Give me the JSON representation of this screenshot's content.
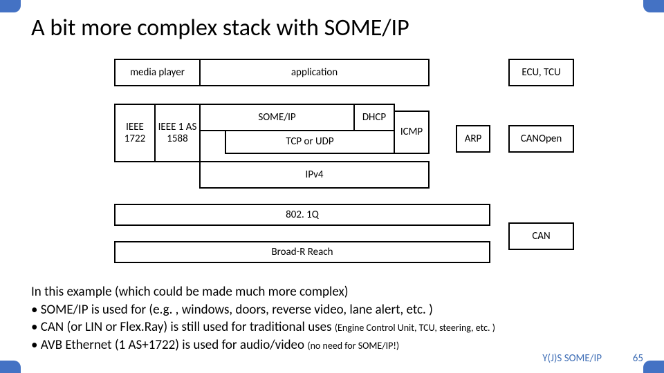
{
  "title": "A bit more complex stack with SOME/IP",
  "diagram": {
    "media_player": "media player",
    "application": "application",
    "ecu_tcu": "ECU, TCU",
    "ieee1722": "IEEE 1722",
    "ieee1as": "IEEE 1 AS 1588",
    "someip": "SOME/IP",
    "dhcp": "DHCP",
    "tcp_udp": "TCP or UDP",
    "icmp": "ICMP",
    "ipv4": "IPv4",
    "arp": "ARP",
    "canopen": "CANOpen",
    "q8021": "802. 1Q",
    "broadr": "Broad-R Reach",
    "can": "CAN"
  },
  "body": {
    "intro": "In this example (which could be made much more complex)",
    "b1": "SOME/IP is used for (e.g. , windows, doors, reverse video, lane alert, etc. )",
    "b2a": "CAN (or LIN or Flex.Ray) is still used for traditional uses ",
    "b2b": "(Engine Control Unit, TCU, steering, etc. )",
    "b3a": "AVB Ethernet (1 AS+1722) is used for audio/video ",
    "b3b": "(no need for SOME/IP!)"
  },
  "bullet": "•",
  "footer": {
    "left": "Y(J)S  SOME/IP",
    "page": "65"
  }
}
